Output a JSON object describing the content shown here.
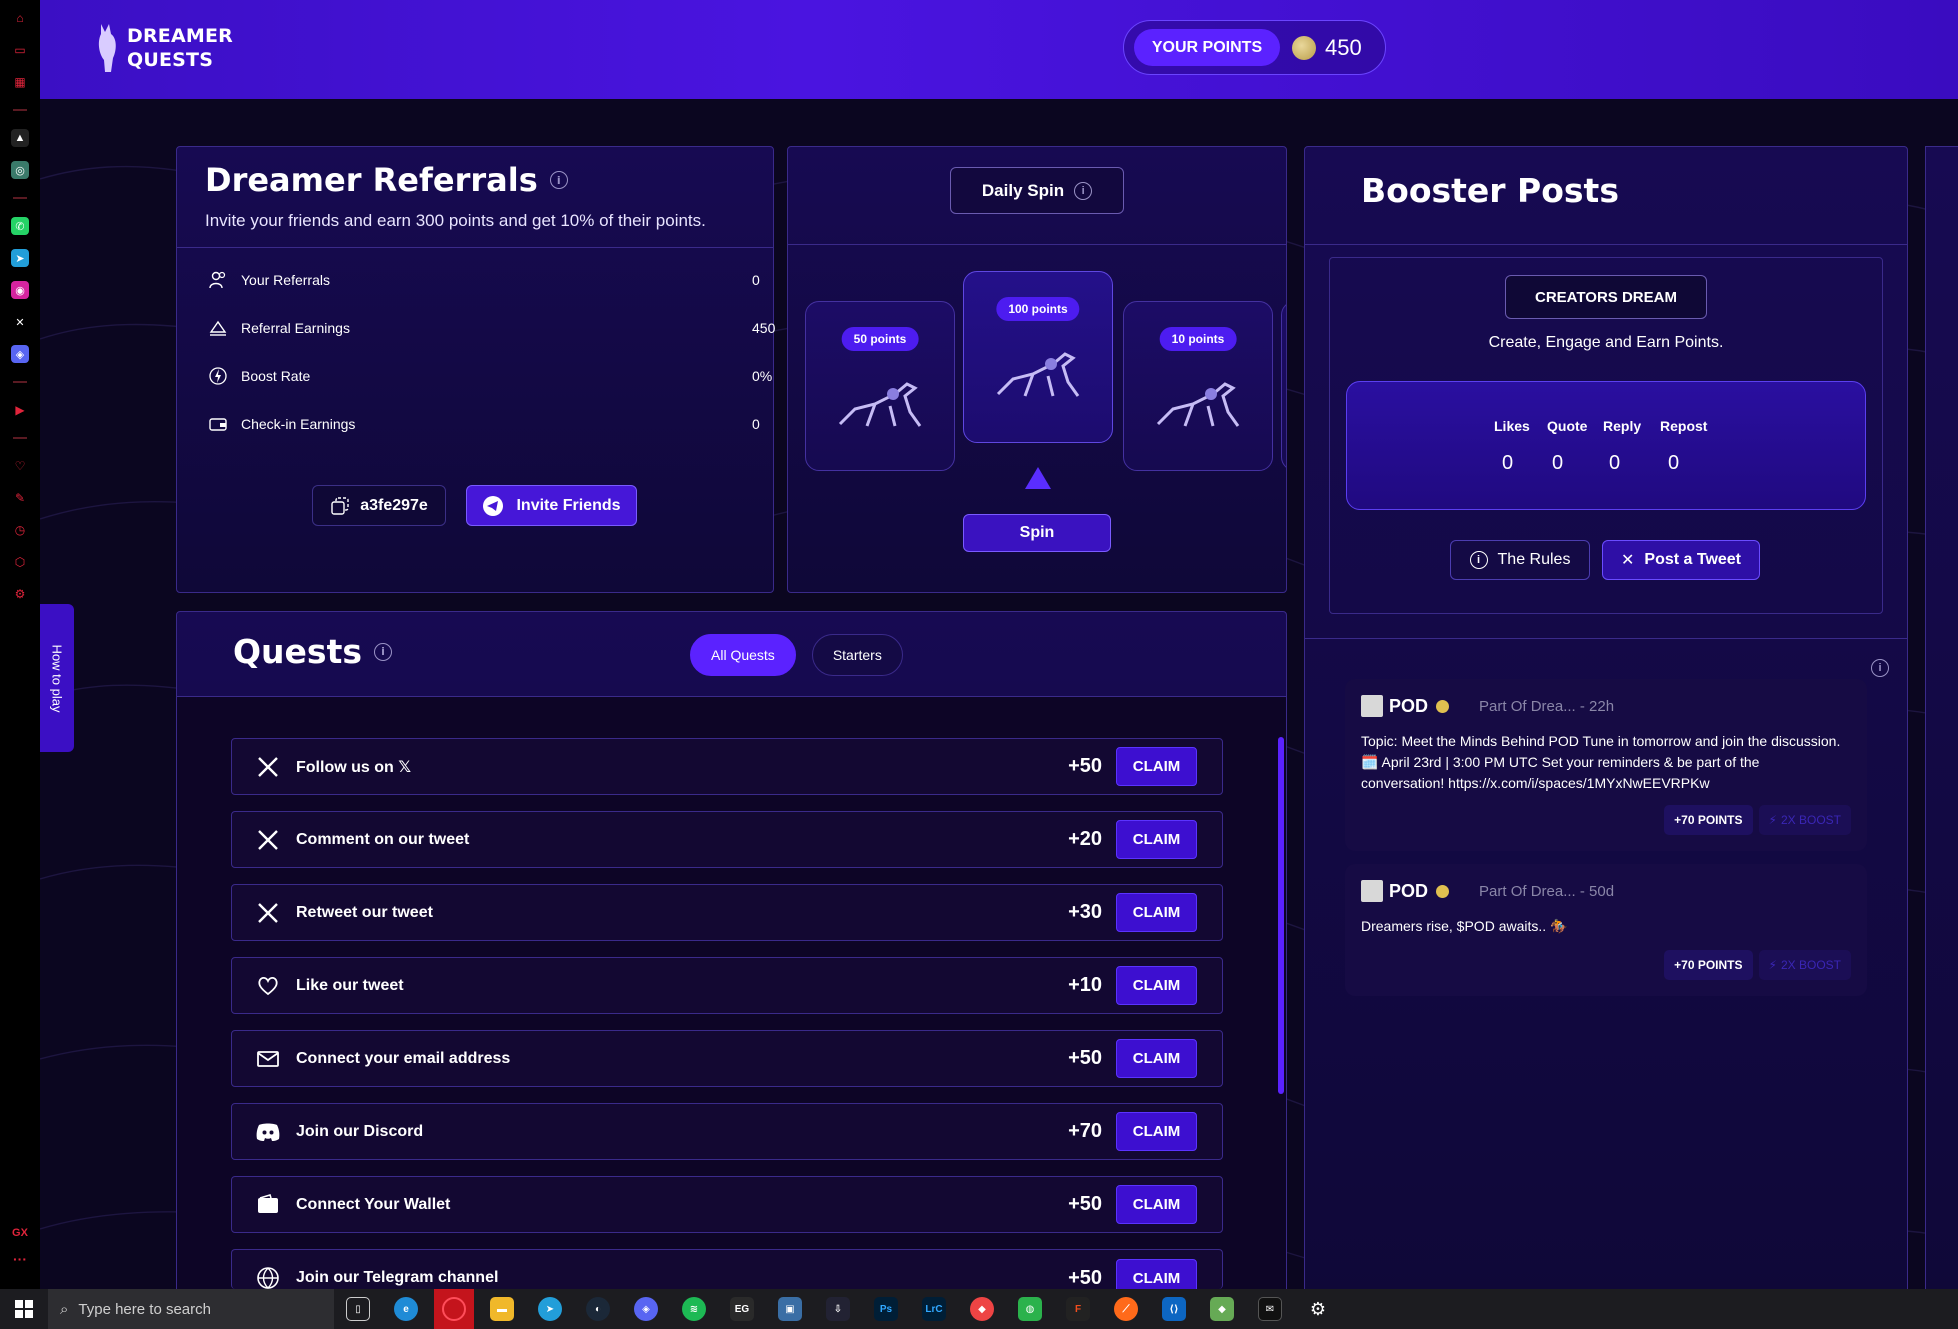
{
  "header": {
    "logo_line1": "DREAMER",
    "logo_line2": "QUESTS",
    "points_label": "YOUR POINTS",
    "points_value": "450"
  },
  "referrals": {
    "title": "Dreamer Referrals",
    "subtitle": "Invite your friends and earn 300 points and get 10% of their points.",
    "rows": [
      {
        "label": "Your Referrals",
        "value": "0",
        "icon": "users-icon"
      },
      {
        "label": "Referral Earnings",
        "value": "450",
        "icon": "earnings-icon"
      },
      {
        "label": "Boost Rate",
        "value": "0%",
        "icon": "bolt-icon"
      },
      {
        "label": "Check-in Earnings",
        "value": "0",
        "icon": "wallet-icon"
      }
    ],
    "code": "a3fe297e",
    "invite_label": "Invite Friends"
  },
  "spin": {
    "title": "Daily Spin",
    "cards": [
      "50 points",
      "100 points",
      "10 points"
    ],
    "button": "Spin"
  },
  "booster": {
    "title": "Booster Posts",
    "creators": "CREATORS DREAM",
    "creators_sub": "Create, Engage and Earn Points.",
    "stats": [
      {
        "label": "Likes",
        "value": "0"
      },
      {
        "label": "Quote",
        "value": "0"
      },
      {
        "label": "Reply",
        "value": "0"
      },
      {
        "label": "Repost",
        "value": "0"
      }
    ],
    "rules_label": "The Rules",
    "tweet_label": "Post a Tweet",
    "posts": [
      {
        "name": "POD",
        "meta": "Part Of Drea... -  22h",
        "body": "Topic: Meet the Minds Behind POD Tune in tomorrow and join the discussion. 🗓️ April 23rd | 3:00 PM UTC Set your reminders & be part of the conversation! https://x.com/i/spaces/1MYxNwEEVRPKw",
        "points": "+70 POINTS",
        "boost": "2X BOOST"
      },
      {
        "name": "POD",
        "meta": "Part Of Drea... -  50d",
        "body": "Dreamers rise, $POD awaits.. 🏇",
        "points": "+70 POINTS",
        "boost": "2X BOOST"
      }
    ]
  },
  "quests": {
    "title": "Quests",
    "tabs": [
      "All Quests",
      "Starters"
    ],
    "claim_label": "CLAIM",
    "items": [
      {
        "label": "Follow us on 𝕏",
        "points": "+50",
        "icon": "x-icon"
      },
      {
        "label": "Comment on our tweet",
        "points": "+20",
        "icon": "x-icon"
      },
      {
        "label": "Retweet our tweet",
        "points": "+30",
        "icon": "x-icon"
      },
      {
        "label": "Like our tweet",
        "points": "+10",
        "icon": "heart-icon"
      },
      {
        "label": "Connect your email address",
        "points": "+50",
        "icon": "mail-icon"
      },
      {
        "label": "Join our Discord",
        "points": "+70",
        "icon": "discord-icon"
      },
      {
        "label": "Connect Your Wallet",
        "points": "+50",
        "icon": "wallet-icon"
      },
      {
        "label": "Join our Telegram channel",
        "points": "+50",
        "icon": "globe-icon"
      }
    ]
  },
  "howto": "How to play",
  "taskbar": {
    "search_placeholder": "Type here to search"
  }
}
